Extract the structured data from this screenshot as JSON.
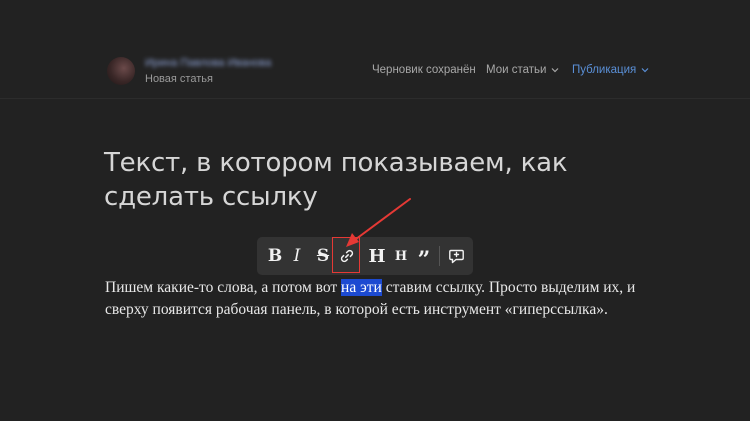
{
  "header": {
    "author_name": "Ирина Павлова Иванова",
    "story_label": "Новая статья",
    "draft_status": "Черновик сохранён",
    "my_articles": "Мои статьи",
    "publish": "Публикация"
  },
  "article": {
    "title": "Текст, в котором показываем, как сделать ссылку",
    "paragraph_before": "Пишем какие-то слова, а потом вот ",
    "paragraph_selected": "на эти",
    "paragraph_after": " ставим ссылку. Просто выделим их, и сверху появится рабочая панель, в которой есть инструмент «гиперссылка»."
  },
  "toolbar": {
    "bold": "B",
    "italic": "I",
    "strike": "S",
    "link_icon": "link-icon",
    "heading_big": "H",
    "heading_small": "H",
    "quote": "”",
    "comment_icon": "comment-add-icon"
  },
  "colors": {
    "background": "#222222",
    "accent": "#5a8fd6",
    "selection": "#1c4ad1",
    "annotation": "#e53935"
  }
}
